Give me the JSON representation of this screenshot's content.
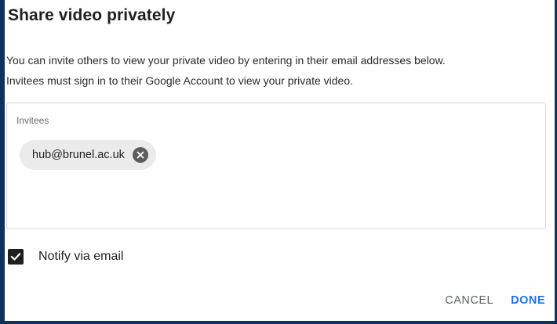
{
  "dialog": {
    "title": "Share video privately",
    "description_line1": "You can invite others to view your private video by entering in their email addresses below.",
    "description_line2": "Invitees must sign in to their Google Account to view your private video."
  },
  "invitees": {
    "label": "Invitees",
    "chips": [
      {
        "email": "hub@brunel.ac.uk",
        "remove_icon": "close-circle-icon"
      }
    ]
  },
  "notify": {
    "label": "Notify via email",
    "checked": true,
    "icon": "checkmark-icon"
  },
  "actions": {
    "cancel_label": "CANCEL",
    "done_label": "DONE"
  },
  "colors": {
    "frame": "#10325a",
    "accent": "#1a73e8",
    "chip_bg": "#ebebeb"
  }
}
